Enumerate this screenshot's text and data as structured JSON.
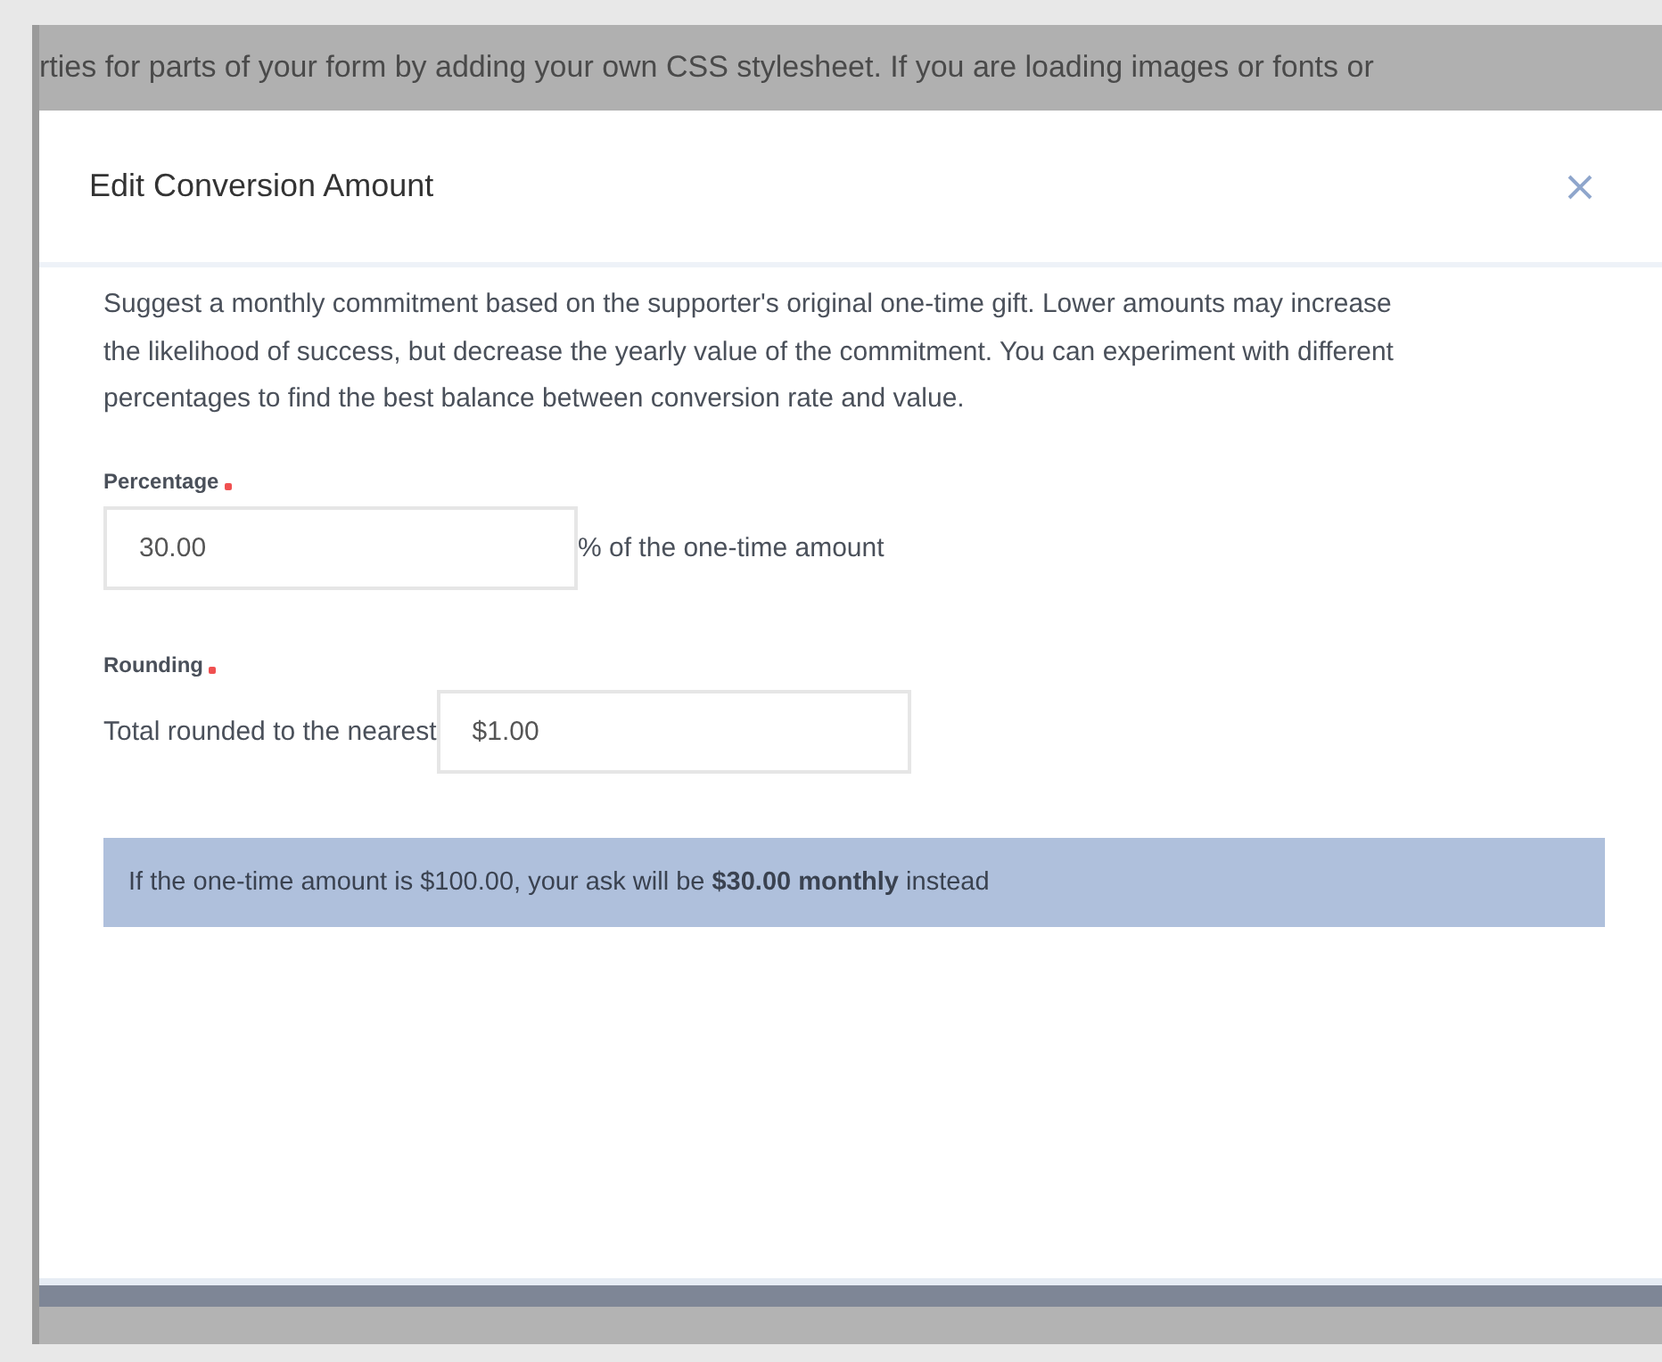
{
  "background_text": "rties for parts of your form by adding your own CSS stylesheet. If you are loading images or fonts or",
  "dialog": {
    "title": "Edit Conversion Amount",
    "description": "Suggest a monthly commitment based on the supporter's original one-time gift. Lower amounts may increase the likelihood of success, but decrease the yearly value of the commitment. You can experiment with different percentages to find the best balance between conversion rate and value.",
    "fields": [
      {
        "kind": "suffix",
        "label": "Percentage",
        "required": true,
        "value": "30.00",
        "text": "% of the one-time amount"
      },
      {
        "kind": "prefix",
        "label": "Rounding",
        "required": true,
        "value": "$1.00",
        "text": "Total rounded to the nearest"
      }
    ],
    "preview": "If the one-time amount is $100.00, your ask will be **$30.00 monthly** instead"
  }
}
